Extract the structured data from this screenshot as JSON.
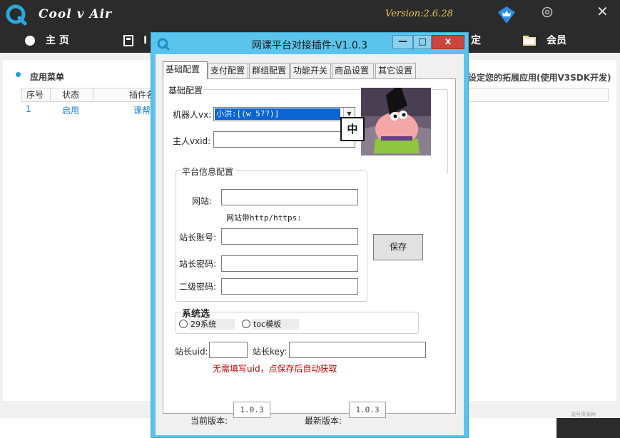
{
  "app": {
    "title": "Cool v Air",
    "version": "Version:2.6.28",
    "close_glyph": "✕",
    "menu": [
      {
        "label": "主 页",
        "icon": "home-icon"
      },
      {
        "label": "I",
        "icon": "document-icon"
      },
      {
        "label": "定",
        "icon": ""
      },
      {
        "label": "会员",
        "icon": "folder-icon"
      }
    ],
    "section_title": "应用菜单",
    "ext_note": "设定您的拓展应用(使用V3SDK开发)",
    "table": {
      "columns": [
        "序号",
        "状态",
        "插件名"
      ],
      "rows": [
        [
          "1",
          "启用",
          "课帮"
        ]
      ]
    },
    "watermark": "溢号资源网"
  },
  "dialog": {
    "title": "网课平台对接插件-V1.0.3",
    "min_glyph": "—",
    "max_glyph": "□",
    "close_glyph": "x",
    "tabs": [
      "基础配置",
      "支付配置",
      "群组配置",
      "功能开关",
      "商品设置",
      "其它设置"
    ],
    "basic": {
      "legend": "基础配置",
      "robot_label": "机器人vx:",
      "robot_value": "小洪:[(w                     5??)]",
      "owner_label": "主人vxid:",
      "owner_value": "",
      "ime_indicator": "中"
    },
    "platform": {
      "legend": "平台信息配置",
      "site_label": "网站:",
      "site_value": "",
      "site_hint": "网站带http/https:",
      "account_label": "站长账号:",
      "account_value": "",
      "password_label": "站长密码:",
      "password_value": "",
      "secondary_label": "二级密码:",
      "secondary_value": ""
    },
    "save_label": "保存",
    "system": {
      "legend": "系统选",
      "options": [
        "29系统",
        "toc模板"
      ]
    },
    "uid_label": "站长uid:",
    "uid_value": "",
    "key_label": "站长key:",
    "key_value": "",
    "uid_hint": "无需填写uid，点保存后自动获取",
    "current_version_label": "当前版本:",
    "current_version": "1.0.3",
    "latest_version_label": "最新版本:",
    "latest_version": "1.0.3"
  },
  "colors": {
    "titlebar": "#2b2b2b",
    "dialog_frame": "#5bc4ec",
    "selection": "#0a64d2",
    "hint_red": "#c00000",
    "link_blue": "#1e7fd6",
    "version_gold": "#e8c55a"
  }
}
